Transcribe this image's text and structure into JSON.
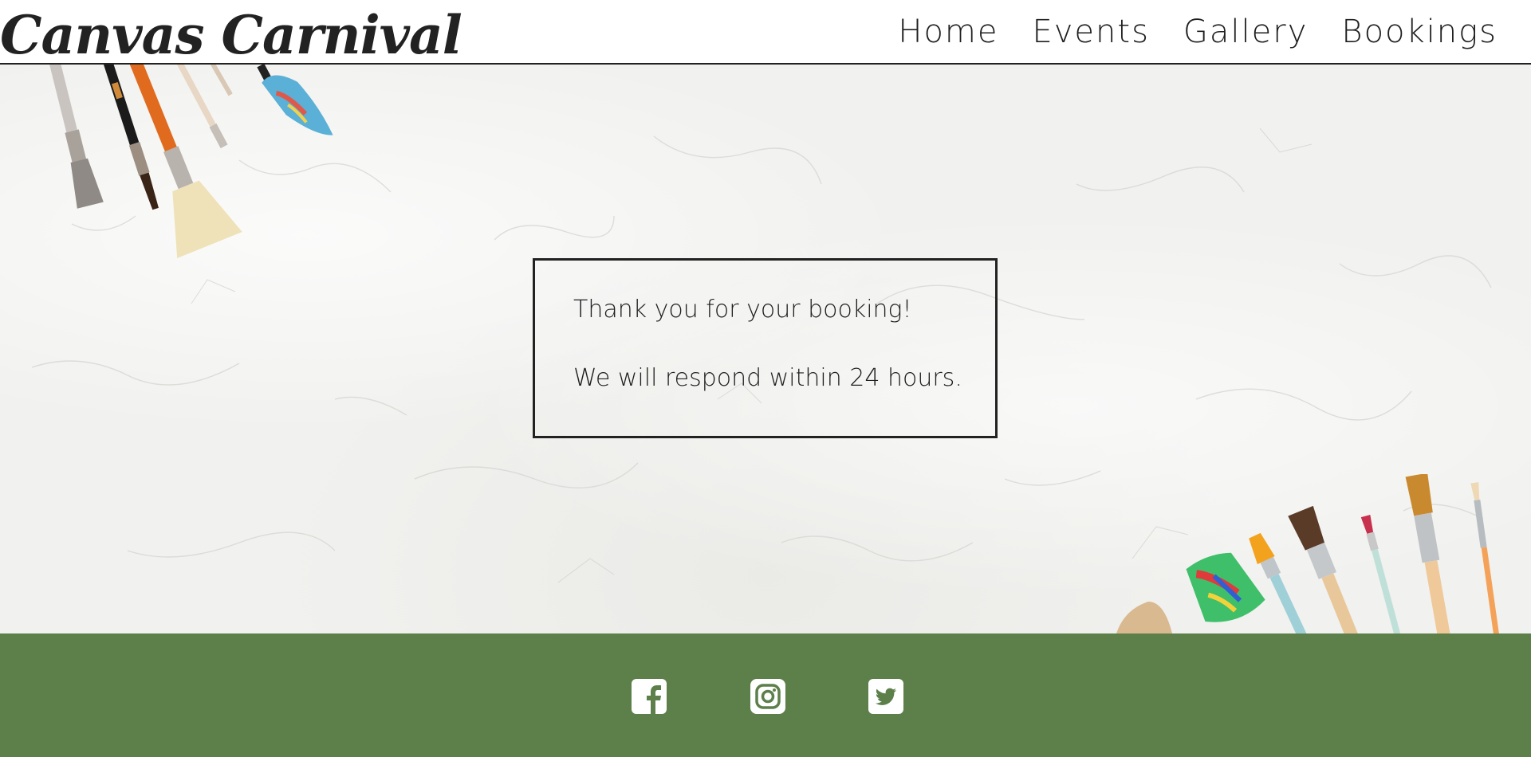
{
  "site": {
    "logo": "Canvas Carnival"
  },
  "nav": {
    "items": [
      {
        "label": "Home"
      },
      {
        "label": "Events"
      },
      {
        "label": "Gallery"
      },
      {
        "label": "Bookings"
      }
    ]
  },
  "confirmation": {
    "line1": "Thank you for your booking!",
    "line2": "We will respond within 24 hours."
  },
  "footer": {
    "social": [
      {
        "icon": "facebook-icon"
      },
      {
        "icon": "instagram-icon"
      },
      {
        "icon": "twitter-icon"
      }
    ]
  },
  "colors": {
    "footer_bg": "#5d804a",
    "text": "#1f1f1f",
    "hero_bg": "#f1f1ef"
  }
}
